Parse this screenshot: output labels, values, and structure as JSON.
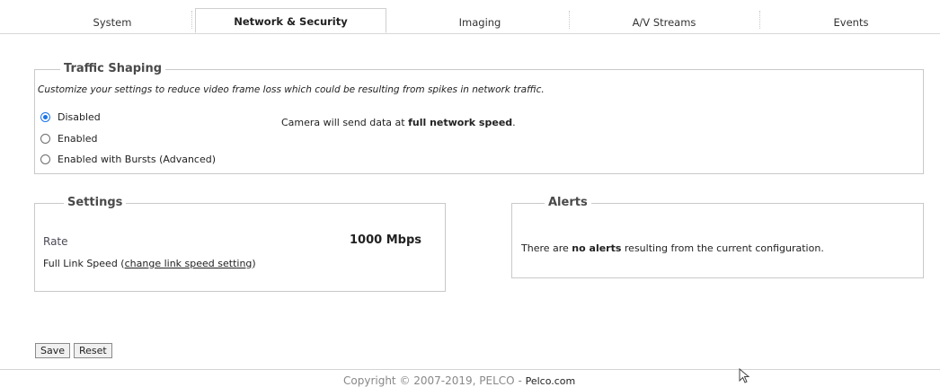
{
  "tabs": [
    {
      "label": "System",
      "active": false
    },
    {
      "label": "Network & Security",
      "active": true
    },
    {
      "label": "Imaging",
      "active": false
    },
    {
      "label": "A/V Streams",
      "active": false
    },
    {
      "label": "Events",
      "active": false
    }
  ],
  "traffic_shaping": {
    "legend": "Traffic Shaping",
    "description": "Customize your settings to reduce video frame loss which could be resulting from spikes in network traffic.",
    "options": [
      {
        "label": "Disabled",
        "selected": true
      },
      {
        "label": "Enabled",
        "selected": false
      },
      {
        "label": "Enabled with Bursts (Advanced)",
        "selected": false
      }
    ],
    "message_prefix": "Camera will send data at ",
    "message_bold": "full network speed",
    "message_suffix": "."
  },
  "settings": {
    "legend": "Settings",
    "rate_label": "Rate",
    "rate_value": "1000 Mbps",
    "link_speed_prefix": "Full Link Speed (",
    "link_speed_link": "change link speed setting",
    "link_speed_suffix": ")"
  },
  "alerts": {
    "legend": "Alerts",
    "message_prefix": "There are ",
    "message_bold": "no alerts",
    "message_suffix": " resulting from the current configuration."
  },
  "buttons": {
    "save": "Save",
    "reset": "Reset"
  },
  "footer": {
    "copyright": "Copyright © 2007-2019, PELCO - ",
    "site": "Pelco.com"
  },
  "colors": {
    "radio_selected": "#1a73e8",
    "border": "#c9c9c9"
  }
}
